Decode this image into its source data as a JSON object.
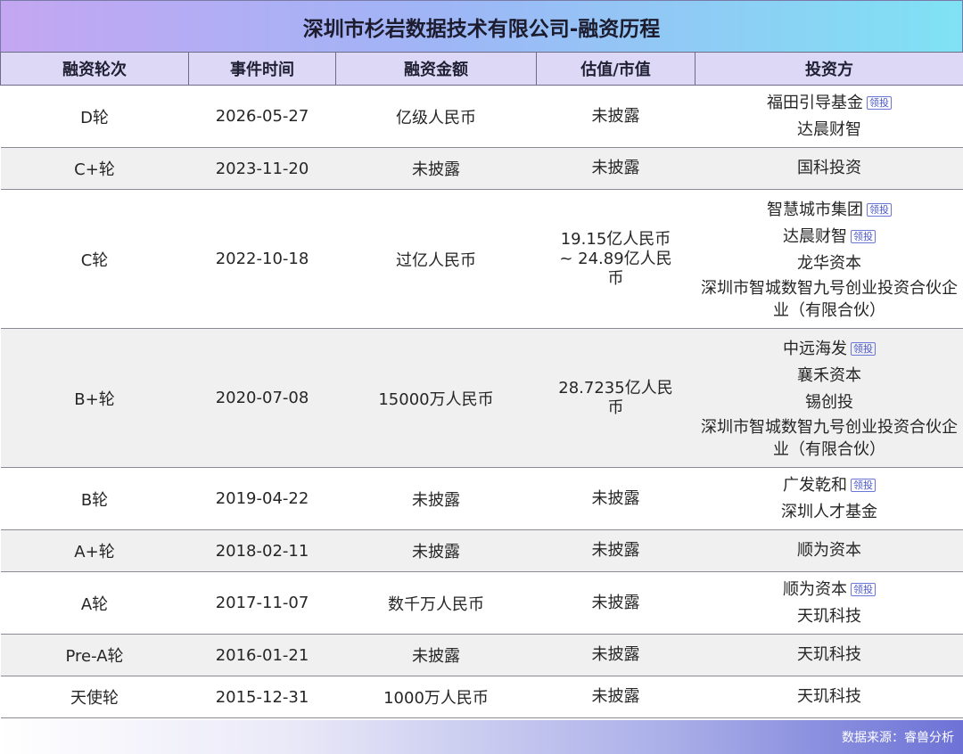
{
  "title": "深圳市杉岩数据技术有限公司-融资历程",
  "headers": [
    "融资轮次",
    "事件时间",
    "融资金额",
    "估值/市值",
    "投资方"
  ],
  "lead_badge": "领投",
  "rounds": [
    {
      "round": "D轮",
      "date": "2026-05-27",
      "amount": "亿级人民币",
      "valuation": "未披露",
      "investors": [
        {
          "name": "福田引导基金",
          "lead": true
        },
        {
          "name": "达晨财智",
          "lead": false
        }
      ]
    },
    {
      "round": "C+轮",
      "date": "2023-11-20",
      "amount": "未披露",
      "valuation": "未披露",
      "investors": [
        {
          "name": "国科投资",
          "lead": false
        }
      ]
    },
    {
      "round": "C轮",
      "date": "2022-10-18",
      "amount": "过亿人民币",
      "valuation": "19.15亿人民币 ~ 24.89亿人民币",
      "investors": [
        {
          "name": "智慧城市集团",
          "lead": true
        },
        {
          "name": "达晨财智",
          "lead": true
        },
        {
          "name": "龙华资本",
          "lead": false
        },
        {
          "name": "深圳市智城数智九号创业投资合伙企业（有限合伙）",
          "lead": false
        }
      ]
    },
    {
      "round": "B+轮",
      "date": "2020-07-08",
      "amount": "15000万人民币",
      "valuation": "28.7235亿人民币",
      "investors": [
        {
          "name": "中远海发",
          "lead": true
        },
        {
          "name": "襄禾资本",
          "lead": false
        },
        {
          "name": "锡创投",
          "lead": false
        },
        {
          "name": "深圳市智城数智九号创业投资合伙企业（有限合伙）",
          "lead": false
        }
      ]
    },
    {
      "round": "B轮",
      "date": "2019-04-22",
      "amount": "未披露",
      "valuation": "未披露",
      "investors": [
        {
          "name": "广发乾和",
          "lead": true
        },
        {
          "name": "深圳人才基金",
          "lead": false
        }
      ]
    },
    {
      "round": "A+轮",
      "date": "2018-02-11",
      "amount": "未披露",
      "valuation": "未披露",
      "investors": [
        {
          "name": "顺为资本",
          "lead": false
        }
      ]
    },
    {
      "round": "A轮",
      "date": "2017-11-07",
      "amount": "数千万人民币",
      "valuation": "未披露",
      "investors": [
        {
          "name": "顺为资本",
          "lead": true
        },
        {
          "name": "天玑科技",
          "lead": false
        }
      ]
    },
    {
      "round": "Pre-A轮",
      "date": "2016-01-21",
      "amount": "未披露",
      "valuation": "未披露",
      "investors": [
        {
          "name": "天玑科技",
          "lead": false
        }
      ]
    },
    {
      "round": "天使轮",
      "date": "2015-12-31",
      "amount": "1000万人民币",
      "valuation": "未披露",
      "investors": [
        {
          "name": "天玑科技",
          "lead": false
        }
      ]
    }
  ],
  "footer": "数据来源：睿兽分析"
}
